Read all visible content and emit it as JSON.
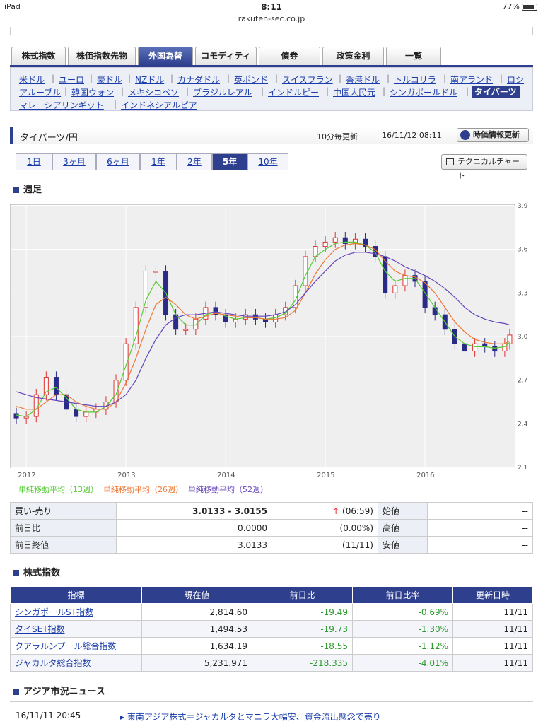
{
  "status": {
    "device": "iPad",
    "time": "8:11",
    "battery": "77%"
  },
  "url": "rakuten-sec.co.jp",
  "tabs": [
    "株式指数",
    "株価指数先物",
    "外国為替",
    "コモディティ",
    "債券",
    "政策金利",
    "一覧"
  ],
  "active_tab": 2,
  "currencies_row1": [
    "米ドル",
    "ユーロ",
    "豪ドル",
    "NZドル",
    "カナダドル",
    "英ポンド",
    "スイスフラン",
    "香港ドル",
    "トルコリラ",
    "南アランド",
    "ロシ"
  ],
  "currencies_row2": [
    "アルーブル",
    "韓国ウォン",
    "メキシコペソ",
    "ブラジルレアル",
    "インドルピー",
    "中国人民元",
    "シンガポールドル",
    "タイバーツ"
  ],
  "currencies_row3": [
    "マレーシアリンギット",
    "インドネシアルピア"
  ],
  "section": {
    "title": "タイバーツ/円",
    "update_note": "10分毎更新",
    "timestamp": "16/11/12 08:11",
    "refresh_label": "時価情報更新"
  },
  "periods": [
    "1日",
    "3ヶ月",
    "6ヶ月",
    "1年",
    "2年",
    "5年",
    "10年"
  ],
  "active_period": 5,
  "technical_label": "テクニカルチャート",
  "chart_heading": "週足",
  "chart_data": {
    "type": "line",
    "subtype": "candlestick-with-moving-averages",
    "x": [
      2011.7,
      2011.8,
      2011.9,
      2012.0,
      2012.1,
      2012.2,
      2012.3,
      2012.4,
      2012.5,
      2012.6,
      2012.7,
      2012.8,
      2012.9,
      2013.0,
      2013.1,
      2013.2,
      2013.3,
      2013.4,
      2013.5,
      2013.6,
      2013.7,
      2013.8,
      2013.9,
      2014.0,
      2014.1,
      2014.2,
      2014.3,
      2014.4,
      2014.5,
      2014.6,
      2014.7,
      2014.8,
      2014.9,
      2015.0,
      2015.1,
      2015.2,
      2015.3,
      2015.4,
      2015.5,
      2015.6,
      2015.7,
      2015.8,
      2015.9,
      2016.0,
      2016.1,
      2016.2,
      2016.3,
      2016.4,
      2016.5,
      2016.6,
      2016.7,
      2016.8,
      2016.85
    ],
    "series": [
      {
        "name": "price",
        "color": "#3a3a9a",
        "values": [
          2.5,
          2.47,
          2.44,
          2.45,
          2.6,
          2.72,
          2.6,
          2.5,
          2.45,
          2.48,
          2.5,
          2.55,
          2.7,
          2.95,
          3.2,
          3.45,
          3.45,
          3.15,
          3.05,
          3.05,
          3.12,
          3.2,
          3.15,
          3.1,
          3.12,
          3.15,
          3.12,
          3.1,
          3.15,
          3.2,
          3.35,
          3.55,
          3.62,
          3.65,
          3.68,
          3.64,
          3.67,
          3.62,
          3.55,
          3.3,
          3.35,
          3.42,
          3.38,
          3.2,
          3.15,
          3.05,
          2.95,
          2.9,
          2.95,
          2.93,
          2.9,
          2.95,
          3.01
        ]
      },
      {
        "name": "単純移動平均（13週）",
        "color": "#55cc33",
        "values": [
          2.55,
          2.5,
          2.46,
          2.45,
          2.5,
          2.62,
          2.65,
          2.58,
          2.5,
          2.48,
          2.48,
          2.52,
          2.6,
          2.8,
          3.0,
          3.25,
          3.38,
          3.3,
          3.15,
          3.08,
          3.08,
          3.15,
          3.17,
          3.14,
          3.12,
          3.13,
          3.13,
          3.12,
          3.13,
          3.16,
          3.25,
          3.42,
          3.55,
          3.6,
          3.64,
          3.65,
          3.65,
          3.63,
          3.58,
          3.45,
          3.38,
          3.4,
          3.4,
          3.3,
          3.2,
          3.1,
          3.0,
          2.95,
          2.93,
          2.93,
          2.92,
          2.93,
          2.96
        ]
      },
      {
        "name": "単純移動平均（26週）",
        "color": "#ee7733",
        "values": [
          2.6,
          2.55,
          2.52,
          2.5,
          2.5,
          2.55,
          2.6,
          2.6,
          2.55,
          2.52,
          2.5,
          2.5,
          2.55,
          2.68,
          2.85,
          3.05,
          3.22,
          3.27,
          3.22,
          3.15,
          3.12,
          3.14,
          3.16,
          3.15,
          3.14,
          3.13,
          3.13,
          3.12,
          3.12,
          3.13,
          3.18,
          3.3,
          3.43,
          3.53,
          3.6,
          3.63,
          3.64,
          3.63,
          3.6,
          3.52,
          3.45,
          3.42,
          3.41,
          3.37,
          3.3,
          3.2,
          3.1,
          3.03,
          2.98,
          2.96,
          2.95,
          2.95,
          2.97
        ]
      },
      {
        "name": "単純移動平均（52週）",
        "color": "#6644bb",
        "values": [
          2.68,
          2.65,
          2.62,
          2.6,
          2.58,
          2.57,
          2.56,
          2.55,
          2.54,
          2.53,
          2.52,
          2.52,
          2.55,
          2.6,
          2.7,
          2.85,
          2.98,
          3.08,
          3.13,
          3.15,
          3.15,
          3.16,
          3.17,
          3.16,
          3.15,
          3.14,
          3.14,
          3.14,
          3.15,
          3.17,
          3.22,
          3.3,
          3.38,
          3.45,
          3.52,
          3.56,
          3.58,
          3.58,
          3.57,
          3.55,
          3.52,
          3.48,
          3.45,
          3.42,
          3.38,
          3.33,
          3.27,
          3.2,
          3.15,
          3.12,
          3.1,
          3.09,
          3.08
        ]
      }
    ],
    "xticks": [
      "2012",
      "2013",
      "2014",
      "2015",
      "2016"
    ],
    "xtick_values": [
      2012,
      2013,
      2014,
      2015,
      2016
    ],
    "yticks": [
      "2.1",
      "2.4",
      "2.7",
      "3.0",
      "3.3",
      "3.6",
      "3.9"
    ],
    "ylim": [
      2.1,
      3.9
    ],
    "xlim": [
      2011.85,
      2016.9
    ],
    "grid": true
  },
  "legend": [
    {
      "label": "単純移動平均（13週）",
      "color": "#55cc33"
    },
    {
      "label": "単純移動平均（26週）",
      "color": "#ee7733"
    },
    {
      "label": "単純移動平均（52週）",
      "color": "#6644bb"
    }
  ],
  "quote": {
    "bid_ask_label": "買い-売り",
    "bid_ask": "3.0133 - 3.0155",
    "arrow": "↑",
    "time": "(06:59)",
    "change_label": "前日比",
    "change": "0.0000",
    "change_pct": "(0.00%)",
    "prev_close_label": "前日終値",
    "prev_close": "3.0133",
    "prev_date": "(11/11)",
    "open_label": "始値",
    "open": "--",
    "high_label": "高値",
    "high": "--",
    "low_label": "安値",
    "low": "--"
  },
  "indices_heading": "株式指数",
  "indices_headers": [
    "指標",
    "現在値",
    "前日比",
    "前日比率",
    "更新日時"
  ],
  "indices_rows": [
    [
      "シンガポールST指数",
      "2,814.60",
      "-19.49",
      "-0.69%",
      "11/11"
    ],
    [
      "タイSET指数",
      "1,494.53",
      "-19.73",
      "-1.30%",
      "11/11"
    ],
    [
      "クアラルンプール総合指数",
      "1,634.19",
      "-18.55",
      "-1.12%",
      "11/11"
    ],
    [
      "ジャカルタ総合指数",
      "5,231.971",
      "-218.335",
      "-4.01%",
      "11/11"
    ]
  ],
  "news_heading": "アジア市況ニュース",
  "news": {
    "date": "16/11/11 20:45",
    "title": "東南アジア株式＝ジャカルタとマニラ大幅安、資金流出懸念で売り"
  }
}
